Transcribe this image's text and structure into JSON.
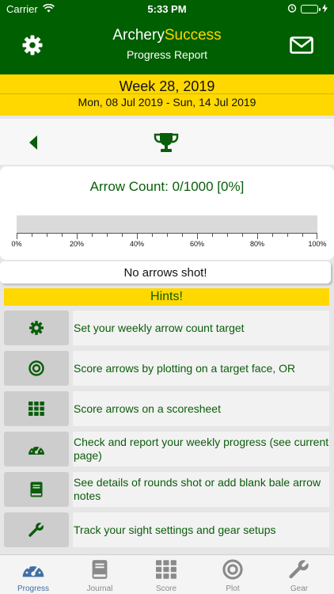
{
  "status_bar": {
    "carrier": "Carrier",
    "time": "5:33 PM"
  },
  "header": {
    "title_part1": "Archery",
    "title_part2": "Success",
    "subtitle": "Progress Report",
    "settings_icon": "gear-icon",
    "mail_icon": "envelope-icon"
  },
  "week": {
    "title": "Week 28, 2019",
    "range": "Mon, 08 Jul 2019 - Sun, 14 Jul 2019"
  },
  "nav": {
    "prev_icon": "triangle-left-icon",
    "trophy_icon": "trophy-icon"
  },
  "progress": {
    "arrow_count_label": "Arrow Count: 0/1000 [0%]",
    "progress_fraction": 0.0,
    "tick_labels": [
      "0%",
      "20%",
      "40%",
      "60%",
      "80%",
      "100%"
    ],
    "no_arrows_text": "No arrows shot!"
  },
  "hints": {
    "title": "Hints!",
    "items": [
      {
        "icon": "gear-icon",
        "text": "Set your weekly arrow count target"
      },
      {
        "icon": "target-icon",
        "text": "Score arrows by plotting on a target face, OR"
      },
      {
        "icon": "grid-icon",
        "text": "Score arrows on a scoresheet"
      },
      {
        "icon": "gauge-icon",
        "text": "Check and report your weekly progress (see current page)"
      },
      {
        "icon": "book-icon",
        "text": "See details of rounds shot or add blank bale arrow notes"
      },
      {
        "icon": "wrench-icon",
        "text": "Track your sight settings and gear setups"
      }
    ]
  },
  "tabs": [
    {
      "label": "Progress",
      "icon": "gauge-icon",
      "active": true
    },
    {
      "label": "Journal",
      "icon": "book-icon",
      "active": false
    },
    {
      "label": "Score",
      "icon": "grid-icon",
      "active": false
    },
    {
      "label": "Plot",
      "icon": "target-icon",
      "active": false
    },
    {
      "label": "Gear",
      "icon": "wrench-icon",
      "active": false
    }
  ],
  "colors": {
    "header_green": "#005f00",
    "text_green": "#0a5d0a",
    "banner_yellow": "#ffd800",
    "brand_gold": "#ffd700",
    "tab_active_blue": "#3f6fa6",
    "tab_inactive_gray": "#8a8a8a"
  }
}
